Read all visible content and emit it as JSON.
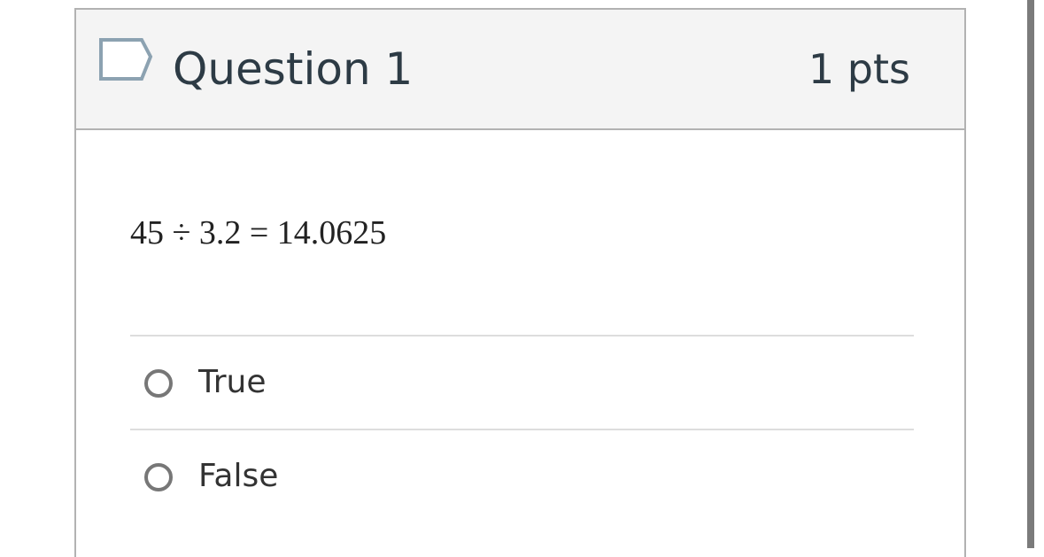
{
  "question": {
    "title": "Question 1",
    "points": "1 pts",
    "text": "45 ÷ 3.2 = 14.0625",
    "flag_icon": "flag-outline-icon"
  },
  "answers": [
    {
      "label": "True"
    },
    {
      "label": "False"
    }
  ],
  "colors": {
    "header_background": "#f4f4f4",
    "border": "#b2b2b2",
    "title_text": "#2d3b45",
    "flag_outline": "#8ca2b1",
    "radio_border": "#777777"
  }
}
